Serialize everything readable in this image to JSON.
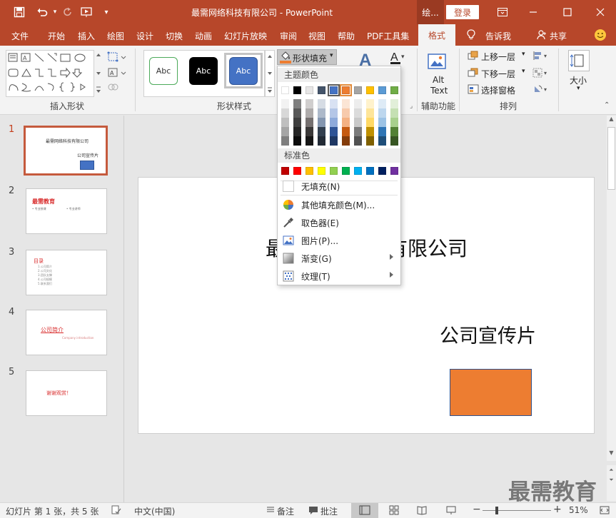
{
  "app": {
    "title": "最需网络科技有限公司 - PowerPoint",
    "context_tab": "绘...",
    "login": "登录"
  },
  "menu": {
    "tabs": [
      "文件",
      "开始",
      "插入",
      "绘图",
      "设计",
      "切换",
      "动画",
      "幻灯片放映",
      "审阅",
      "视图",
      "帮助",
      "PDF工具集",
      "格式"
    ],
    "active": "格式",
    "tell_me": "告诉我",
    "share": "共享"
  },
  "ribbon": {
    "groups": {
      "insert_shapes": "插入形状",
      "shape_styles": "形状样式",
      "accessibility": "辅助功能",
      "arrange": "排列"
    },
    "style_samples": [
      "Abc",
      "Abc",
      "Abc"
    ],
    "shape_fill_label": "形状填充",
    "alt_text": [
      "Alt",
      "Text"
    ],
    "bring_forward": "上移一层",
    "send_backward": "下移一层",
    "selection_pane": "选择窗格",
    "size_label": "大小"
  },
  "dropdown": {
    "theme_colors_label": "主题颜色",
    "theme_colors_top": [
      "#ffffff",
      "#000000",
      "#e7e6e6",
      "#44546a",
      "#4472c4",
      "#ed7d31",
      "#a5a5a5",
      "#ffc000",
      "#5b9bd5",
      "#70ad47"
    ],
    "theme_shades": [
      [
        "#f2f2f2",
        "#7f7f7f",
        "#d0cece",
        "#d6dce4",
        "#d9e2f3",
        "#fbe5d5",
        "#ededed",
        "#fff2cc",
        "#deebf6",
        "#e2efd9"
      ],
      [
        "#d8d8d8",
        "#595959",
        "#aeabab",
        "#adb9ca",
        "#b4c6e7",
        "#f7caac",
        "#dbdbdb",
        "#fee599",
        "#bdd7ee",
        "#c5e0b3"
      ],
      [
        "#bfbfbf",
        "#3f3f3f",
        "#757070",
        "#8496b0",
        "#8eaadb",
        "#f4b183",
        "#c9c9c9",
        "#ffd965",
        "#9cc3e5",
        "#a8d08d"
      ],
      [
        "#a5a5a5",
        "#262626",
        "#3a3838",
        "#323f4f",
        "#2f5496",
        "#c55a11",
        "#7b7b7b",
        "#bf9000",
        "#2e75b5",
        "#538135"
      ],
      [
        "#7f7f7f",
        "#0c0c0c",
        "#161616",
        "#222a35",
        "#1f3864",
        "#843c0b",
        "#525252",
        "#7f6000",
        "#1e4e79",
        "#375623"
      ]
    ],
    "standard_colors_label": "标准色",
    "standard_colors": [
      "#c00000",
      "#ff0000",
      "#ffc000",
      "#ffff00",
      "#92d050",
      "#00b050",
      "#00b0f0",
      "#0070c0",
      "#002060",
      "#7030a0"
    ],
    "items": [
      {
        "label": "无填充(N)",
        "icon": "no-fill-icon",
        "submenu": false
      },
      {
        "label": "其他填充颜色(M)...",
        "icon": "color-wheel-icon",
        "submenu": false
      },
      {
        "label": "取色器(E)",
        "icon": "eyedropper-icon",
        "submenu": false
      },
      {
        "label": "图片(P)...",
        "icon": "picture-icon",
        "submenu": false
      },
      {
        "label": "渐变(G)",
        "icon": "gradient-icon",
        "submenu": true
      },
      {
        "label": "纹理(T)",
        "icon": "texture-icon",
        "submenu": true
      }
    ]
  },
  "slides": [
    {
      "num": "1",
      "title": "最需网络科技有限公司",
      "subtitle": "公司宣传片"
    },
    {
      "num": "2",
      "title": "最需教育",
      "items": [
        "• 专业授课",
        "• 专业讲师"
      ]
    },
    {
      "num": "3",
      "title": "目录",
      "items": [
        "1.公司简介",
        "2.公司文化",
        "3.团队支撑",
        "4.公司规模",
        "5.联系我们"
      ]
    },
    {
      "num": "4",
      "title": "公司简介",
      "subtitle": "Company introduction"
    },
    {
      "num": "5",
      "title": "谢谢观赏！"
    }
  ],
  "main_slide": {
    "title_left": "最",
    "title_right": "有限公司",
    "subtitle": "公司宣传片",
    "shape_color": "#ed7d31"
  },
  "status": {
    "slide_count": "幻灯片 第 1 张，共 5 张",
    "language": "中文(中国)",
    "notes": "备注",
    "comments": "批注",
    "zoom": "51%"
  },
  "watermark": "最需教育",
  "colors": {
    "accent": "#b7472a",
    "selected_slide_border": "#c55a3d"
  }
}
